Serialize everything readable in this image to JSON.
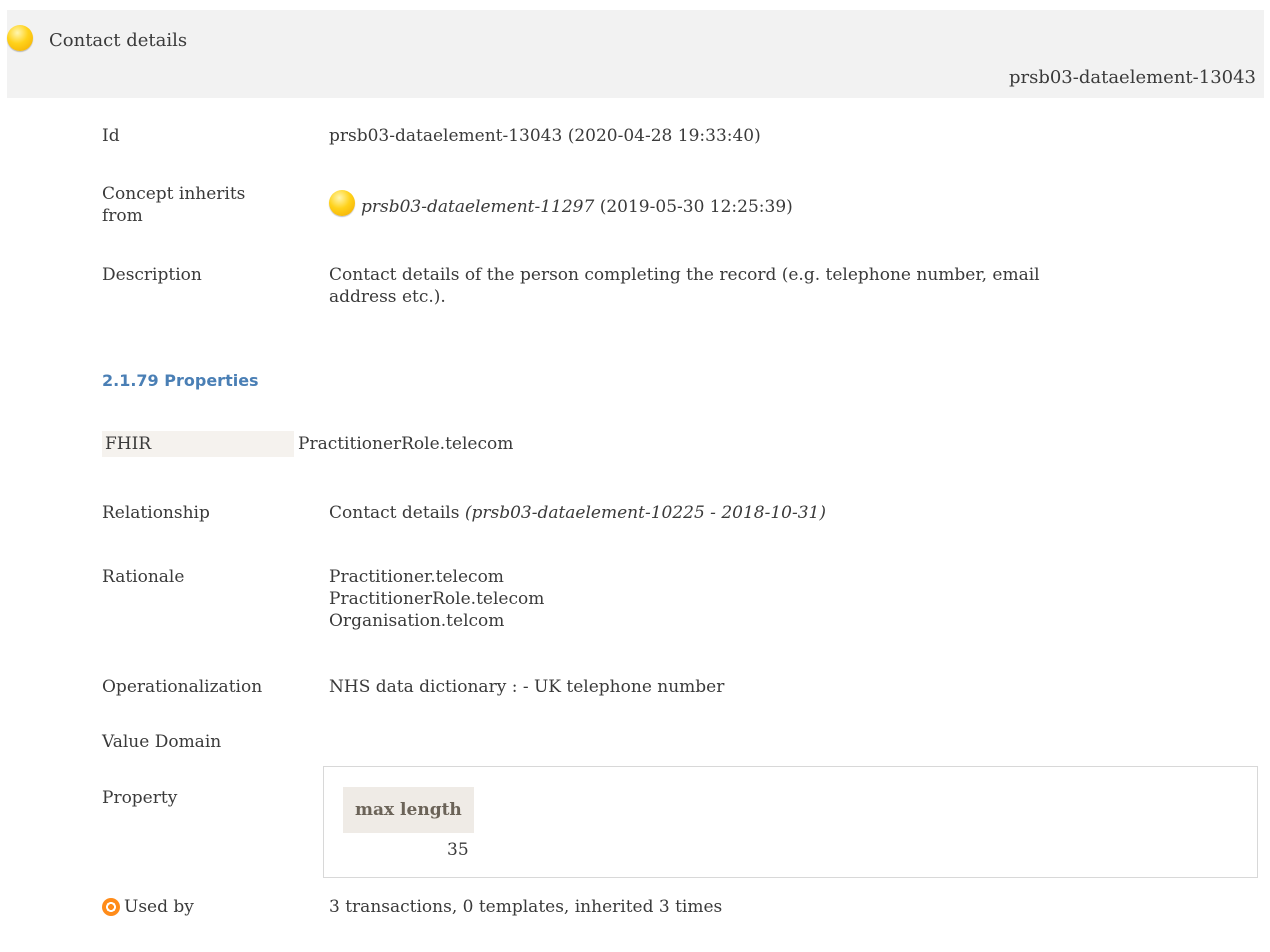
{
  "header": {
    "title": "Contact details",
    "id": "prsb03-dataelement-13043"
  },
  "details": {
    "id_label": "Id",
    "id_value": "prsb03-dataelement-13043 (2020-04-28 19:33:40)",
    "inherits_label_line1": "Concept inherits",
    "inherits_label_line2": "from",
    "inherits_ref": "prsb03-dataelement-11297",
    "inherits_date": " (2019-05-30 12:25:39)",
    "description_label": "Description",
    "description_line1": "Contact details of the person completing the record (e.g. telephone number, email",
    "description_line2": "address etc.)."
  },
  "properties": {
    "heading": "2.1.79 Properties",
    "fhir_label": "FHIR",
    "fhir_value": "PractitionerRole.telecom",
    "relationship_label": "Relationship",
    "relationship_value": "Contact details ",
    "relationship_ref": "(prsb03-dataelement-10225 - 2018-10-31)",
    "rationale_label": "Rationale",
    "rationale_lines": [
      "Practitioner.telecom",
      "PractitionerRole.telecom",
      "Organisation.telcom"
    ],
    "operationalization_label": "Operationalization",
    "operationalization_value": "NHS data dictionary : - UK telephone number",
    "value_domain_label": "Value Domain",
    "property_label": "Property",
    "property_table": {
      "header": "max length",
      "value": "35"
    },
    "used_by_label": "Used by",
    "used_by_value": "3 transactions, 0 templates, inherited 3 times"
  },
  "icons": {
    "status": "yellow-ball-icon",
    "used_by": "target-icon"
  }
}
